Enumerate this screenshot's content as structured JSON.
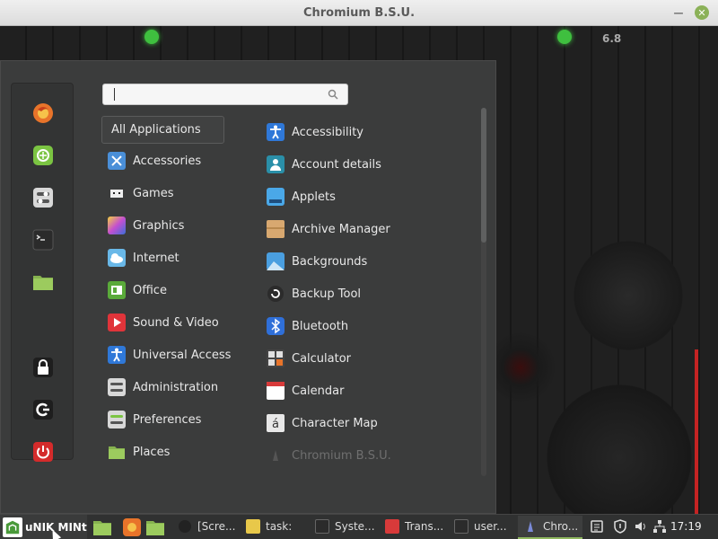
{
  "window": {
    "title": "Chromium B.S.U.",
    "minimize_icon": "minimize-icon",
    "close_icon": "close-icon"
  },
  "game": {
    "version_text": "6.8"
  },
  "menu": {
    "search": {
      "value": "",
      "placeholder": "",
      "icon": "search-icon"
    },
    "favorites": [
      {
        "name": "firefox",
        "icon": "firefox-icon",
        "color": "#e8742a"
      },
      {
        "name": "software-manager",
        "icon": "software-manager-icon",
        "color": "#7bc442"
      },
      {
        "name": "system-settings",
        "icon": "settings-toggle-icon",
        "color": "#d8d8d8"
      },
      {
        "name": "terminal",
        "icon": "terminal-icon",
        "color": "#2b2b2b"
      },
      {
        "name": "files",
        "icon": "folder-icon",
        "color": "#86b24f"
      },
      {
        "name": "lock-screen",
        "icon": "lock-icon",
        "color": "#ffffff"
      },
      {
        "name": "logout",
        "icon": "logout-icon",
        "color": "#ffffff"
      },
      {
        "name": "quit",
        "icon": "power-icon",
        "color": "#d42b2b"
      }
    ],
    "categories": [
      {
        "label": "All Applications",
        "icon": "",
        "selected": true
      },
      {
        "label": "Accessories",
        "icon": "accessories-icon",
        "color": "#4a8fd8"
      },
      {
        "label": "Games",
        "icon": "games-icon",
        "color": "#1e1e1e"
      },
      {
        "label": "Graphics",
        "icon": "graphics-icon",
        "color": "#c44fd0"
      },
      {
        "label": "Internet",
        "icon": "internet-icon",
        "color": "#69b8e8"
      },
      {
        "label": "Office",
        "icon": "office-icon",
        "color": "#5aaa3a"
      },
      {
        "label": "Sound & Video",
        "icon": "sound-video-icon",
        "color": "#e0343a"
      },
      {
        "label": "Universal Access",
        "icon": "universal-access-icon",
        "color": "#2f78d8"
      },
      {
        "label": "Administration",
        "icon": "administration-icon",
        "color": "#d8d8d8"
      },
      {
        "label": "Preferences",
        "icon": "preferences-icon",
        "color": "#d8d8d8"
      },
      {
        "label": "Places",
        "icon": "folder-icon",
        "color": "#86b24f"
      }
    ],
    "applications": [
      {
        "label": "Accessibility",
        "icon": "accessibility-icon",
        "color": "#2f78d8"
      },
      {
        "label": "Account details",
        "icon": "account-details-icon",
        "color": "#2a8fa8"
      },
      {
        "label": "Applets",
        "icon": "applets-icon",
        "color": "#4aa8e8"
      },
      {
        "label": "Archive Manager",
        "icon": "archive-manager-icon",
        "color": "#d8a870"
      },
      {
        "label": "Backgrounds",
        "icon": "backgrounds-icon",
        "color": "#4a9fe0"
      },
      {
        "label": "Backup Tool",
        "icon": "backup-tool-icon",
        "color": "#2b2b2b"
      },
      {
        "label": "Bluetooth",
        "icon": "bluetooth-icon",
        "color": "#2f6fd8"
      },
      {
        "label": "Calculator",
        "icon": "calculator-icon",
        "color": "#444444"
      },
      {
        "label": "Calendar",
        "icon": "calendar-icon",
        "color": "#ffffff"
      },
      {
        "label": "Character Map",
        "icon": "character-map-icon",
        "color": "#e8e8e8"
      },
      {
        "label": "Chromium B.S.U.",
        "icon": "chromium-bsu-icon",
        "color": "#3a3a3a",
        "faded": true
      }
    ]
  },
  "taskbar": {
    "start_label": "uNIK MINt",
    "start_icon": "linux-mint-icon",
    "launchers": [
      {
        "name": "files",
        "icon": "folder-icon"
      },
      {
        "name": "firefox",
        "icon": "firefox-icon"
      },
      {
        "name": "files-2",
        "icon": "folder-icon"
      }
    ],
    "windows": [
      {
        "label": "[Scre...",
        "icon": "screenshot-icon",
        "color": "#222222"
      },
      {
        "label": "task:",
        "icon": "notes-icon",
        "color": "#e8c84a"
      },
      {
        "label": "Syste...",
        "icon": "system-monitor-icon",
        "color": "#2b2b2b"
      },
      {
        "label": "Trans...",
        "icon": "transmission-icon",
        "color": "#d83a3a"
      },
      {
        "label": "user...",
        "icon": "terminal-icon",
        "color": "#2b2b2b"
      },
      {
        "label": "Chro...",
        "icon": "chromium-bsu-icon",
        "color": "#3a4a8a",
        "active": true
      }
    ],
    "tray": [
      {
        "name": "notes",
        "icon": "notes-tray-icon"
      },
      {
        "name": "update-manager",
        "icon": "shield-icon"
      },
      {
        "name": "volume",
        "icon": "volume-icon"
      },
      {
        "name": "network",
        "icon": "network-icon"
      }
    ],
    "clock": "17:19"
  },
  "colors": {
    "accent": "#8fb75f",
    "menu_bg": "#3b3c3c",
    "taskbar_bg": "#303131"
  }
}
